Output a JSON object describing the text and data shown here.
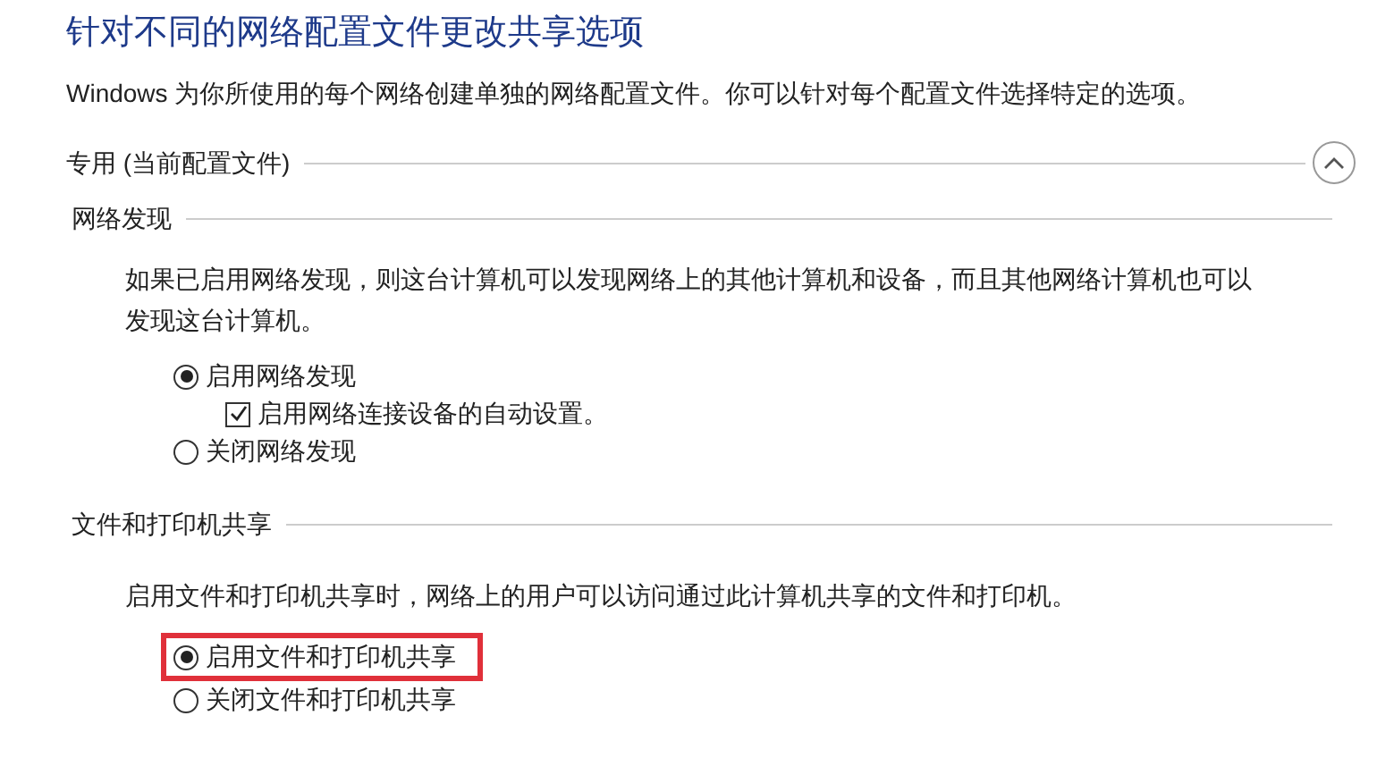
{
  "title": "针对不同的网络配置文件更改共享选项",
  "subtitle": "Windows 为你所使用的每个网络创建单独的网络配置文件。你可以针对每个配置文件选择特定的选项。",
  "profile": {
    "label": "专用 (当前配置文件)",
    "expanded": true,
    "sections": [
      {
        "heading": "网络发现",
        "description": "如果已启用网络发现，则这台计算机可以发现网络上的其他计算机和设备，而且其他网络计算机也可以发现这台计算机。",
        "options": [
          {
            "kind": "radio",
            "label": "启用网络发现",
            "selected": true,
            "highlighted": false
          },
          {
            "kind": "checkbox",
            "label": "启用网络连接设备的自动设置。",
            "checked": true
          },
          {
            "kind": "radio",
            "label": "关闭网络发现",
            "selected": false,
            "highlighted": false
          }
        ]
      },
      {
        "heading": "文件和打印机共享",
        "description": "启用文件和打印机共享时，网络上的用户可以访问通过此计算机共享的文件和打印机。",
        "options": [
          {
            "kind": "radio",
            "label": "启用文件和打印机共享",
            "selected": true,
            "highlighted": true
          },
          {
            "kind": "radio",
            "label": "关闭文件和打印机共享",
            "selected": false,
            "highlighted": false
          }
        ]
      }
    ]
  }
}
